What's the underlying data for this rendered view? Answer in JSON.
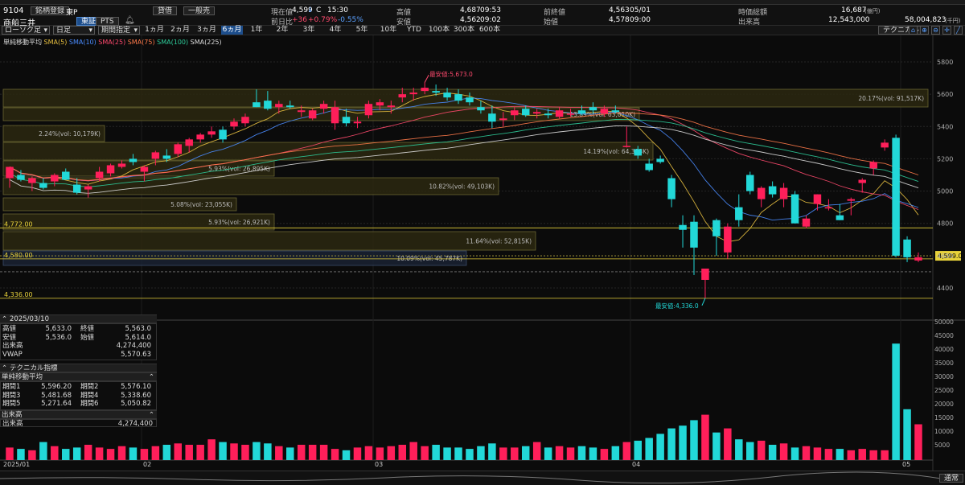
{
  "header": {
    "code": "9104",
    "name": "商船三井",
    "register_label": "銘柄登録",
    "exchange_tse": "東証",
    "exchange_pts": "PTS",
    "market_label": "東P",
    "margin_label": "貸借",
    "general_label": "一般売"
  },
  "quote": {
    "current_label": "現在値",
    "current": "4,599",
    "current_arrow": "↓",
    "current_flag": "C",
    "current_time": "15:30",
    "change_label": "前日比",
    "change": "+36",
    "change_pct": "+0.79%",
    "change_pct2": "-0.55%",
    "high_label": "高値",
    "high": "4,687",
    "high_time": "09:53",
    "low_label": "安値",
    "low": "4,562",
    "low_time": "09:02",
    "prev_close_label": "前終値",
    "prev_close": "4,563",
    "prev_close_date": "05/01",
    "open_label": "始値",
    "open": "4,578",
    "open_time": "09:00",
    "mktcap_label": "時価総額",
    "mktcap": "16,687",
    "mktcap_unit": "(億円)",
    "volume_label": "出来高",
    "volume": "12,543,000",
    "turnover": "58,004,823",
    "turnover_unit": "(千円)"
  },
  "toolbar": {
    "chart_type": "ローソク足",
    "period_type": "日足",
    "range_select": "期間指定",
    "timeframes": [
      "1ヵ月",
      "2ヵ月",
      "3ヵ月",
      "6ヵ月",
      "1年",
      "2年",
      "3年",
      "4年",
      "5年",
      "10年",
      "YTD",
      "100本",
      "300本",
      "600本"
    ],
    "selected_timeframe": "6ヵ月",
    "technical_label": "テクニカル"
  },
  "legend": {
    "title": "単純移動平均",
    "items": [
      {
        "label": "SMA(5)",
        "color": "#e8c040"
      },
      {
        "label": "SMA(10)",
        "color": "#4a8cff"
      },
      {
        "label": "SMA(25)",
        "color": "#ff4a6e"
      },
      {
        "label": "SMA(75)",
        "color": "#ff7a4a"
      },
      {
        "label": "SMA(100)",
        "color": "#2ecc9a"
      },
      {
        "label": "SMA(225)",
        "color": "#dddddd"
      }
    ]
  },
  "annotations": {
    "high_label": "最安値:5,673.0",
    "low_label": "最安値:4,336.0",
    "line_4772": "4,772.00",
    "line_4580": "4,580.00",
    "line_4336": "4,336.00",
    "current_tag": "4,599.0"
  },
  "volume_profile": [
    "20.17%(vol: 91,517K)",
    "13.89%(vol: 63,010K)",
    "2.24%(vol: 10,179K)",
    "14.19%(vol: 64,393K)",
    "5.93%(vol: 26,895K)",
    "10.82%(vol: 49,103K)",
    "5.08%(vol: 23,055K)",
    "5.93%(vol: 26,921K)",
    "11.64%(vol: 52,815K)",
    "10.09%(vol: 45,787K)"
  ],
  "price_axis": [
    "5800",
    "5600",
    "5400",
    "5200",
    "5000",
    "4800",
    "4600",
    "4400"
  ],
  "volume_axis": [
    "50000",
    "45000",
    "40000",
    "35000",
    "30000",
    "25000",
    "20000",
    "15000",
    "10000",
    "5000"
  ],
  "date_axis": [
    "2025/01",
    "02",
    "03",
    "04",
    "05"
  ],
  "day_panel": {
    "date": "2025/03/10",
    "rows": [
      {
        "k1": "高値",
        "v1": "5,633.0",
        "k2": "終値",
        "v2": "5,563.0"
      },
      {
        "k1": "安値",
        "v1": "5,536.0",
        "k2": "始値",
        "v2": "5,614.0"
      },
      {
        "k1": "出来高",
        "v1": "",
        "k2": "",
        "v2": "4,274,400"
      },
      {
        "k1": "VWAP",
        "v1": "",
        "k2": "",
        "v2": "5,570.63"
      }
    ]
  },
  "tech_panel": {
    "title": "テクニカル指標",
    "sma_title": "単純移動平均",
    "rows": [
      {
        "k1": "期間1",
        "v1": "5,596.20",
        "k2": "期間2",
        "v2": "5,576.10"
      },
      {
        "k1": "期間3",
        "v1": "5,481.68",
        "k2": "期間4",
        "v2": "5,338.60"
      },
      {
        "k1": "期間5",
        "v1": "5,271.64",
        "k2": "期間6",
        "v2": "5,050.82"
      }
    ],
    "vol_title": "出来高",
    "vol_label": "出来高",
    "vol_value": "4,274,400"
  },
  "footer": {
    "mode": "通常"
  },
  "colors": {
    "up": "#ff1f5a",
    "down": "#22d8d8",
    "bg": "#0b0b0b"
  }
}
